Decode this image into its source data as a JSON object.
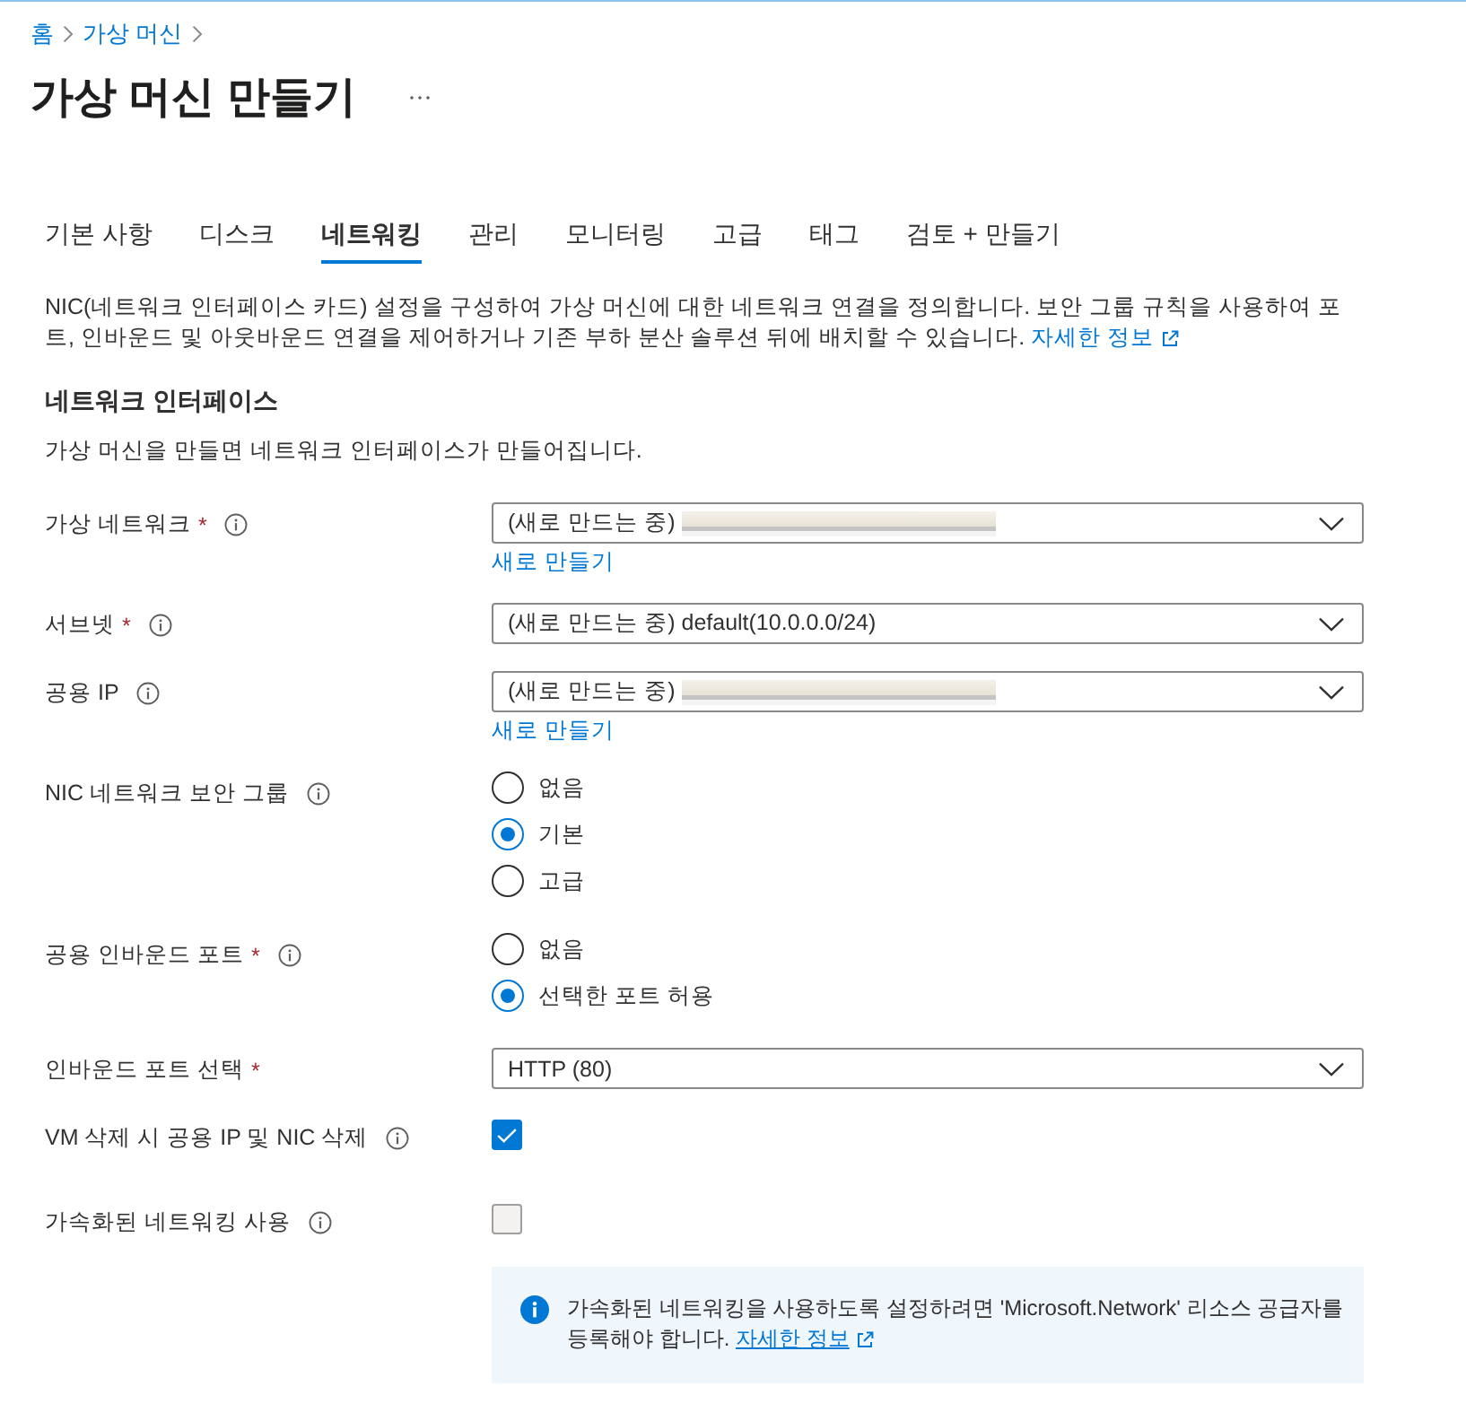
{
  "breadcrumb": [
    {
      "label": "홈"
    },
    {
      "label": "가상 머신"
    }
  ],
  "page_title": "가상 머신 만들기",
  "tabs": [
    {
      "label": "기본 사항",
      "selected": false
    },
    {
      "label": "디스크",
      "selected": false
    },
    {
      "label": "네트워킹",
      "selected": true
    },
    {
      "label": "관리",
      "selected": false
    },
    {
      "label": "모니터링",
      "selected": false
    },
    {
      "label": "고급",
      "selected": false
    },
    {
      "label": "태그",
      "selected": false
    },
    {
      "label": "검토 + 만들기",
      "selected": false
    }
  ],
  "description": {
    "text": "NIC(네트워크 인터페이스 카드) 설정을 구성하여 가상 머신에 대한 네트워크 연결을 정의합니다. 보안 그룹 규칙을 사용하여 포트, 인바운드 및 아웃바운드 연결을 제어하거나 기존 부하 분산 솔루션 뒤에 배치할 수 있습니다.",
    "link": "자세한 정보"
  },
  "section": {
    "title": "네트워크 인터페이스",
    "subtitle": "가상 머신을 만들면 네트워크 인터페이스가 만들어집니다."
  },
  "fields": [
    {
      "kind": "dropdown",
      "label": "가상 네트워크",
      "required_mark": "*",
      "info": true,
      "value": "(새로 만드는 중)",
      "redacted": true,
      "link": "새로 만들기"
    },
    {
      "kind": "dropdown",
      "label": "서브넷",
      "required_mark": "*",
      "info": true,
      "value": "(새로 만드는 중) default(10.0.0.0/24)",
      "redacted": false
    },
    {
      "kind": "dropdown",
      "label": "공용 IP",
      "info": true,
      "value": "(새로 만드는 중)",
      "redacted": true,
      "link": "새로 만들기"
    },
    {
      "kind": "radio",
      "label": "NIC 네트워크 보안 그룹",
      "info": true,
      "options": [
        {
          "label": "없음",
          "selected": false
        },
        {
          "label": "기본",
          "selected": true
        },
        {
          "label": "고급",
          "selected": false
        }
      ]
    },
    {
      "kind": "radio",
      "label": "공용 인바운드 포트",
      "required_mark": "*",
      "info": true,
      "options": [
        {
          "label": "없음",
          "selected": false
        },
        {
          "label": "선택한 포트 허용",
          "selected": true
        }
      ]
    },
    {
      "kind": "dropdown",
      "label": "인바운드 포트 선택",
      "required_mark": "*",
      "info": false,
      "value": "HTTP (80)",
      "redacted": false
    },
    {
      "kind": "checkbox",
      "label": "VM 삭제 시 공용 IP 및 NIC 삭제",
      "info": true,
      "checked": true,
      "disabled": false
    },
    {
      "kind": "checkbox",
      "label": "가속화된 네트워킹 사용",
      "info": true,
      "checked": false,
      "disabled": true
    }
  ],
  "info_box": {
    "text": "가속화된 네트워킹을 사용하도록 설정하려면 'Microsoft.Network' 리소스 공급자를 등록해야 합니다.",
    "link": "자세한 정보"
  }
}
